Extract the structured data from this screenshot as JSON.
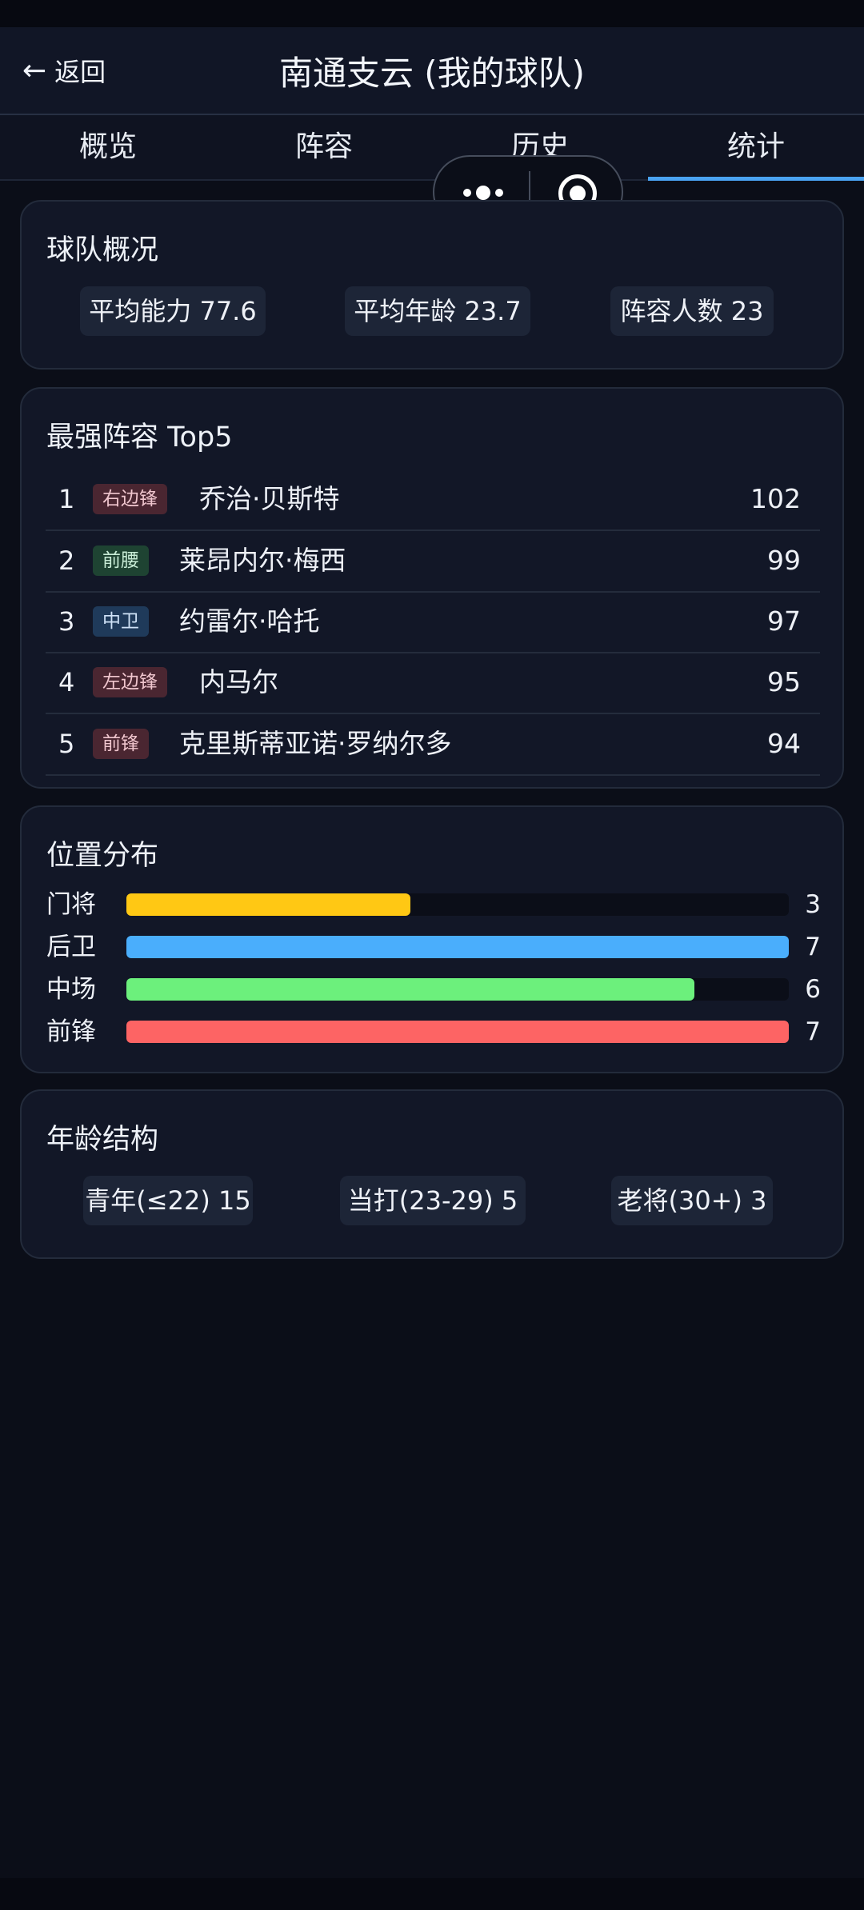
{
  "header": {
    "back_label": "返回",
    "title": "南通支云 (我的球队)"
  },
  "tabs": [
    {
      "label": "概览",
      "active": false
    },
    {
      "label": "阵容",
      "active": false
    },
    {
      "label": "历史",
      "active": false
    },
    {
      "label": "统计",
      "active": true
    }
  ],
  "capsule": {
    "more_icon": "more-dots-icon",
    "close_icon": "target-icon"
  },
  "overview": {
    "title": "球队概况",
    "chips": [
      "平均能力 77.6",
      "平均年龄 23.7",
      "阵容人数 23"
    ]
  },
  "top5": {
    "title": "最强阵容 Top5",
    "players": [
      {
        "rank": "1",
        "position": "右边锋",
        "name": "乔治·贝斯特",
        "score": "102",
        "badge_bg": "#4a2631",
        "badge_fg": "#f0c6ce"
      },
      {
        "rank": "2",
        "position": "前腰",
        "name": "莱昂内尔·梅西",
        "score": "99",
        "badge_bg": "#1e4332",
        "badge_fg": "#c8ecd6"
      },
      {
        "rank": "3",
        "position": "中卫",
        "name": "约雷尔·哈托",
        "score": "97",
        "badge_bg": "#1f3a5a",
        "badge_fg": "#cfe2f7"
      },
      {
        "rank": "4",
        "position": "左边锋",
        "name": "内马尔",
        "score": "95",
        "badge_bg": "#4a2631",
        "badge_fg": "#f0c6ce"
      },
      {
        "rank": "5",
        "position": "前锋",
        "name": "克里斯蒂亚诺·罗纳尔多",
        "score": "94",
        "badge_bg": "#4a2631",
        "badge_fg": "#f0c6ce"
      }
    ]
  },
  "positions": {
    "title": "位置分布",
    "max": 7,
    "items": [
      {
        "label": "门将",
        "count": 3,
        "count_text": "3",
        "color": "#ffc814"
      },
      {
        "label": "后卫",
        "count": 7,
        "count_text": "7",
        "color": "#4aaefc"
      },
      {
        "label": "中场",
        "count": 6,
        "count_text": "6",
        "color": "#6cf07c"
      },
      {
        "label": "前锋",
        "count": 7,
        "count_text": "7",
        "color": "#fd6464"
      }
    ]
  },
  "ages": {
    "title": "年龄结构",
    "chips": [
      "青年(≤22) 15",
      "当打(23-29) 5",
      "老将(30+) 3"
    ]
  }
}
